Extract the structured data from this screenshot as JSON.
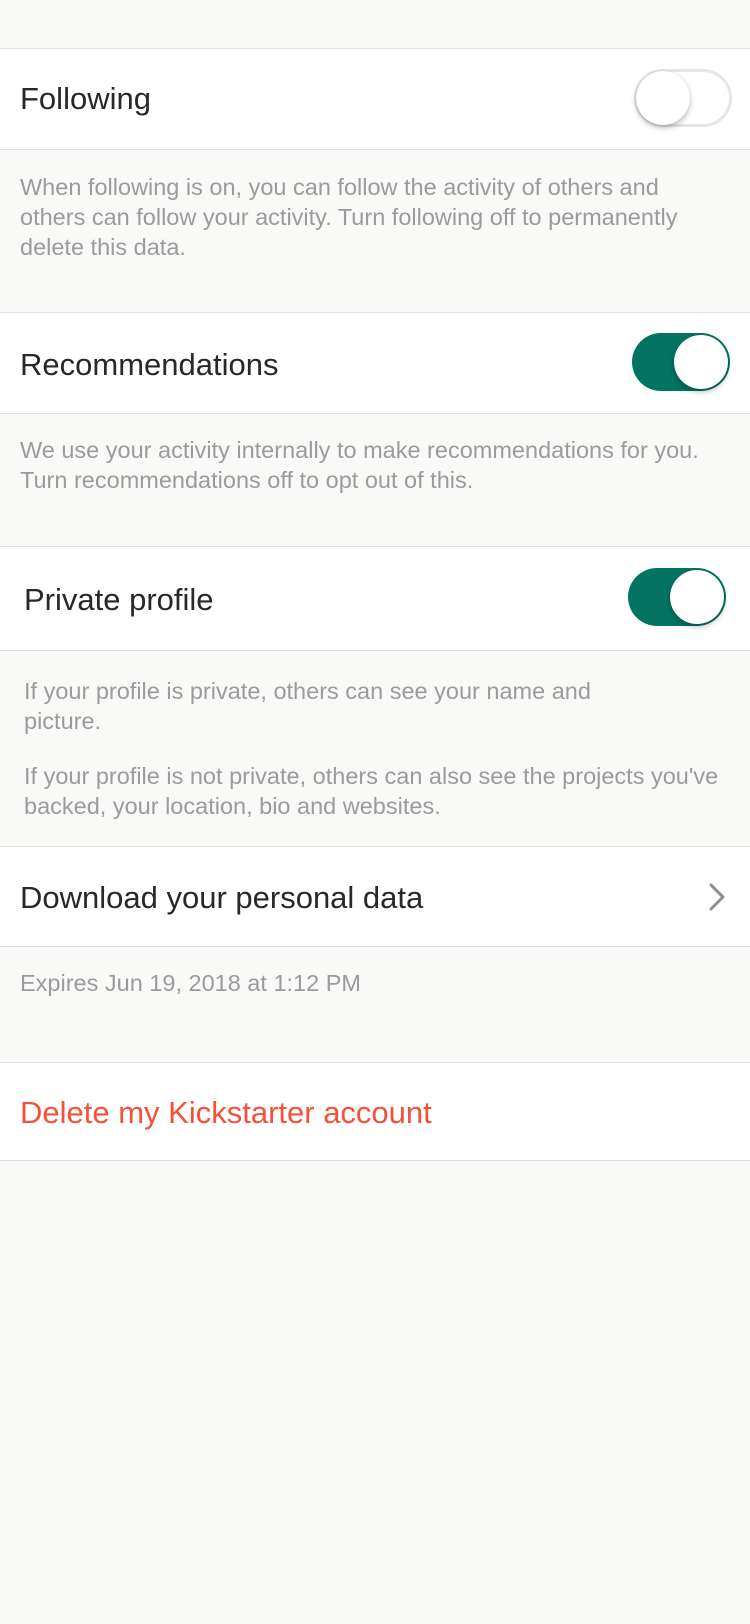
{
  "settings": {
    "following": {
      "label": "Following",
      "enabled": false,
      "description": "When following is on, you can follow the activity of others and others can follow your activity. Turn following off to permanently delete this data."
    },
    "recommendations": {
      "label": "Recommendations",
      "enabled": true,
      "description": "We use your activity internally to make recommendations for you. Turn recommendations off to opt out of this."
    },
    "private_profile": {
      "label": "Private profile",
      "enabled": true,
      "description_1": "If your profile is private, others can see your name and picture.",
      "description_2": "If your profile is not private, others can also see the projects you've backed, your location, bio and websites."
    },
    "download": {
      "label": "Download your personal data",
      "icon": "chevron-right-icon",
      "expires": "Expires Jun 19, 2018 at 1:12 PM"
    },
    "delete": {
      "label": "Delete my Kickstarter account"
    }
  },
  "colors": {
    "toggle_on": "#037362",
    "danger": "#f5503b",
    "background": "#f9f9f8",
    "secondary_text": "#9b9b9b",
    "primary_text": "#282828"
  }
}
